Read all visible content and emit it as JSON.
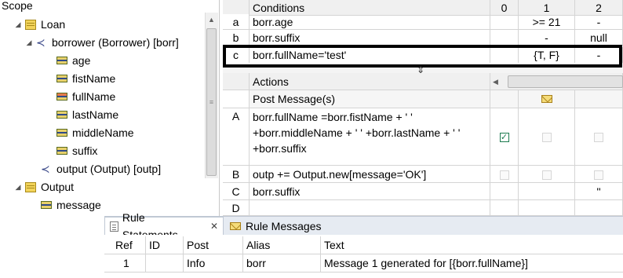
{
  "scope": {
    "title": "Scope",
    "tree": [
      {
        "label": "Loan",
        "type": "entity"
      },
      {
        "label": "borrower (Borrower) [borr]",
        "type": "assoc"
      },
      {
        "label": "age",
        "type": "attr"
      },
      {
        "label": "fistName",
        "type": "attr"
      },
      {
        "label": "fullName",
        "type": "attr-warn"
      },
      {
        "label": "lastName",
        "type": "attr"
      },
      {
        "label": "middleName",
        "type": "attr"
      },
      {
        "label": "suffix",
        "type": "attr"
      },
      {
        "label": "output (Output) [outp]",
        "type": "assoc"
      },
      {
        "label": "Output",
        "type": "entity"
      },
      {
        "label": "message",
        "type": "attr"
      }
    ]
  },
  "conditions": {
    "header": "Conditions",
    "columns": [
      "0",
      "1",
      "2"
    ],
    "rows": [
      {
        "id": "a",
        "expr": "borr.age",
        "c1": ">= 21",
        "c2": "-"
      },
      {
        "id": "b",
        "expr": "borr.suffix",
        "c1": "-",
        "c2": "null"
      },
      {
        "id": "c",
        "expr": "borr.fullName='test'",
        "c1": "{T, F}",
        "c2": "-"
      }
    ]
  },
  "actions": {
    "header": "Actions",
    "post_message": "Post Message(s)",
    "rows": [
      {
        "id": "A",
        "lines": [
          "borr.fullName =borr.fistName + ' '",
          "+borr.middleName + ' ' +borr.lastName + ' '",
          "+borr.suffix"
        ]
      },
      {
        "id": "B",
        "lines": [
          "outp += Output.new[message='OK']"
        ]
      },
      {
        "id": "C",
        "lines": [
          "borr.suffix"
        ],
        "c2": "''"
      },
      {
        "id": "D",
        "lines": [
          ""
        ]
      }
    ]
  },
  "tabs": {
    "rule_statements": "Rule Statements",
    "rule_messages": "Rule Messages",
    "close": "✕"
  },
  "messages": {
    "headers": [
      "Ref",
      "ID",
      "Post",
      "Alias",
      "Text"
    ],
    "rows": [
      {
        "ref": "1",
        "id": "",
        "post": "Info",
        "alias": "borr",
        "text": "Message 1 generated for [{borr.fullName}]"
      }
    ]
  }
}
